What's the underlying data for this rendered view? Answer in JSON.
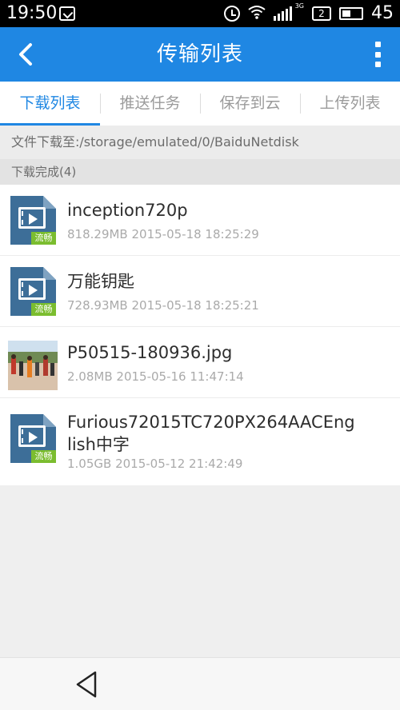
{
  "status_bar": {
    "time": "19:50",
    "sim_number": "2",
    "network_type": "3G",
    "battery_level": "45",
    "battery_fraction": 0.45
  },
  "app_bar": {
    "title": "传输列表",
    "back_icon": "chevron-left-icon",
    "more_icon": "more-vertical-icon"
  },
  "tabs": [
    {
      "label": "下载列表",
      "active": true
    },
    {
      "label": "推送任务",
      "active": false
    },
    {
      "label": "保存到云",
      "active": false
    },
    {
      "label": "上传列表",
      "active": false
    }
  ],
  "download_path": "文件下载至:/storage/emulated/0/BaiduNetdisk",
  "section_header": "下载完成(4)",
  "files": [
    {
      "name": "inception720p",
      "meta": "818.29MB 2015-05-18 18:25:29",
      "type": "video",
      "badge": "流畅"
    },
    {
      "name": "万能钥匙",
      "meta": "728.93MB 2015-05-18 18:25:21",
      "type": "video",
      "badge": "流畅"
    },
    {
      "name": "P50515-180936.jpg",
      "meta": "2.08MB 2015-05-16 11:47:14",
      "type": "image"
    },
    {
      "name": "Furious72015TC720PX264AACEnglish中字",
      "meta": "1.05GB 2015-05-12 21:42:49",
      "type": "video",
      "badge": "流畅"
    }
  ],
  "colors": {
    "accent": "#1f87e3",
    "video_icon": "#3d6e98",
    "stream_badge": "#7bbd2f"
  }
}
